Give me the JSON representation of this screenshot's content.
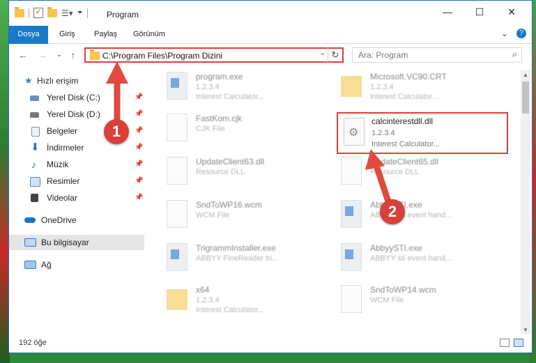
{
  "window": {
    "title": "Program",
    "minimize": "—",
    "maximize": "☐",
    "close": "✕",
    "help": "?",
    "collapse": "⌄"
  },
  "ribbon": {
    "tabs": [
      "Dosya",
      "Giriş",
      "Paylaş",
      "Görünüm"
    ]
  },
  "navigation": {
    "back": "←",
    "forward": "→",
    "recent": "⌄",
    "up": "↑",
    "address": "C:\\Program Files\\Program Dizini",
    "search_placeholder": "Ara: Program"
  },
  "sidebar": {
    "items": [
      {
        "label": "Hızlı erişim",
        "icon": "star-icon",
        "pinned": false
      },
      {
        "label": "Yerel Disk (C:)",
        "icon": "drive-icon",
        "pinned": true
      },
      {
        "label": "Yerel Disk (D:)",
        "icon": "drive-icon",
        "pinned": true
      },
      {
        "label": "Belgeler",
        "icon": "documents-icon",
        "pinned": true
      },
      {
        "label": "İndirmeler",
        "icon": "download-icon",
        "pinned": true
      },
      {
        "label": "Müzik",
        "icon": "music-icon",
        "pinned": true
      },
      {
        "label": "Resimler",
        "icon": "pictures-icon",
        "pinned": true
      },
      {
        "label": "Videolar",
        "icon": "videos-icon",
        "pinned": true
      },
      {
        "label": "OneDrive",
        "icon": "cloud-icon",
        "pinned": false
      },
      {
        "label": "Bu bilgisayar",
        "icon": "computer-icon",
        "pinned": false
      },
      {
        "label": "Ağ",
        "icon": "network-icon",
        "pinned": false
      }
    ],
    "pin_glyph": "📌"
  },
  "files": [
    {
      "name": "program.exe",
      "line2": "1.2.3.4",
      "line3": "Interest Calculator...",
      "type": "app"
    },
    {
      "name": "Microsoft.VC90.CRT",
      "line2": "1.2.3.4",
      "line3": "Interest Calculator...",
      "type": "folder"
    },
    {
      "name": "FastKom.cjk",
      "line2": "CJK File",
      "line3": "",
      "type": "doc"
    },
    {
      "name": "calcinterestdll.dll",
      "line2": "1.2.3.4",
      "line3": "Interest Calculator...",
      "type": "dll"
    },
    {
      "name": "UpdateClient63.dll",
      "line2": "Resource DLL",
      "line3": "",
      "type": "dll"
    },
    {
      "name": "UpdateClient65.dll",
      "line2": "Resource DLL",
      "line3": "",
      "type": "dll"
    },
    {
      "name": "SndToWP16.wcm",
      "line2": "WCM File",
      "line3": "",
      "type": "doc"
    },
    {
      "name": "AbbyySTI.exe",
      "line2": "ABBYY sti event hand...",
      "line3": "",
      "type": "app"
    },
    {
      "name": "TrigrammInstaller.exe",
      "line2": "ABBYY FineReader tri...",
      "line3": "",
      "type": "app"
    },
    {
      "name": "AbbyySTI.exe",
      "line2": "ABBYY sti event hand...",
      "line3": "",
      "type": "app"
    },
    {
      "name": "x64",
      "line2": "1.2.3.4",
      "line3": "Interest Calculator...",
      "type": "folder"
    },
    {
      "name": "SndToWP14.wcm",
      "line2": "WCM File",
      "line3": "",
      "type": "doc"
    }
  ],
  "status": {
    "count": "192 öğe"
  },
  "annotations": {
    "step1": "1",
    "step2": "2",
    "accent_color": "#d9403a"
  }
}
